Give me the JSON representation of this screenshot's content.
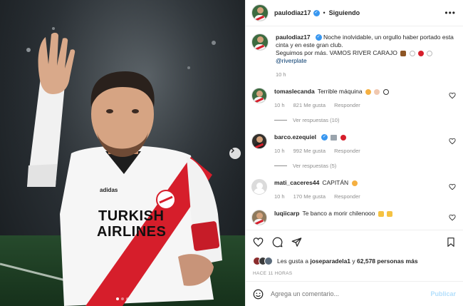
{
  "header": {
    "username": "paulodiaz17",
    "separator": "•",
    "follow_label": "Siguiendo",
    "more_label": "•••"
  },
  "caption": {
    "username": "paulodiaz17",
    "line1": "Noche inolvidable, un orgullo haber portado esta cinta y en este gran club.",
    "line2": "Seguimos por más. VAMOS RIVER CARAJO",
    "mention": "@riverplate",
    "time": "10 h"
  },
  "comments": [
    {
      "username": "tomaslecanda",
      "text": "Terrible máquina",
      "time": "10 h",
      "likes": "821 Me gusta",
      "reply": "Responder",
      "view_replies": "Ver respuestas (10)"
    },
    {
      "username": "barco.ezequiel",
      "text": "",
      "time": "10 h",
      "likes": "992 Me gusta",
      "reply": "Responder",
      "view_replies": "Ver respuestas (5)"
    },
    {
      "username": "mati_caceres44",
      "text": "CAPITÁN",
      "time": "10 h",
      "likes": "170 Me gusta",
      "reply": "Responder"
    },
    {
      "username": "luqiicarp",
      "text": "Te banco a morir chilenooo"
    }
  ],
  "likes": {
    "prefix": "Les gusta a",
    "user": "joseparadela1",
    "connector": "y",
    "others": "62,578 personas más"
  },
  "timeago": "HACE 11 HORAS",
  "composer": {
    "placeholder": "Agrega un comentario...",
    "post_label": "Publicar"
  },
  "photo": {
    "jersey_sponsor_line1": "TURKISH",
    "jersey_sponsor_line2": "AIRLINES",
    "jersey_brand": "adidas",
    "slides_total": 3,
    "slide_active": 1
  },
  "colors": {
    "river_red": "#d61e2b",
    "verified_blue": "#3897f0",
    "link_blue": "#00376b",
    "muted": "#8e8e8e"
  },
  "icons": {
    "like": "heart-icon",
    "comment": "comment-bubble-icon",
    "share": "paper-plane-icon",
    "save": "bookmark-icon",
    "emoji": "smiley-icon",
    "next": "chevron-right-icon",
    "options": "more-dots-icon"
  }
}
